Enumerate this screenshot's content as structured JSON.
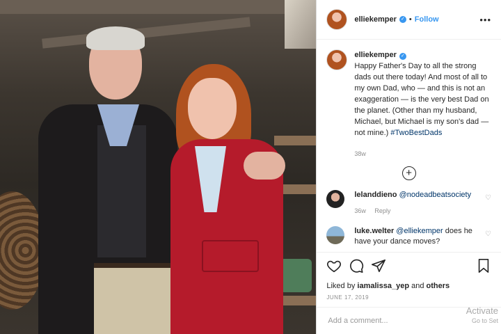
{
  "header": {
    "username": "elliekemper",
    "follow_label": "Follow",
    "separator": "•",
    "more_label": "•••"
  },
  "caption": {
    "username": "elliekemper",
    "text": "Happy Father's Day to all the strong dads out there today! And most of all to my own Dad, who — and this is not an exaggeration — is the very best Dad on the planet. (Other than my husband, Michael, but Michael is my son's dad — not mine.)",
    "hashtag": "#TwoBestDads",
    "time": "38w"
  },
  "load_more_label": "+",
  "comments": [
    {
      "username": "lelanddieno",
      "text": "@nodeadbeatsociety",
      "time": "36w",
      "reply_label": "Reply"
    },
    {
      "username": "luke.welter",
      "mention": "@elliekemper",
      "text": "does he have your dance moves?"
    }
  ],
  "likes": {
    "prefix": "Liked by",
    "user": "iamalissa_yep",
    "conjunction": "and",
    "others": "others"
  },
  "post_date": "JUNE 17, 2019",
  "add_comment_placeholder": "Add a comment...",
  "watermark": {
    "line1": "Activate",
    "line2": "Go to Set"
  },
  "colors": {
    "link_blue": "#3897f0",
    "hashtag_blue": "#003569",
    "muted": "#8e8e8e"
  },
  "icons": {
    "like": "heart-icon",
    "comment": "comment-icon",
    "share": "send-icon",
    "save": "bookmark-icon",
    "verified": "verified-badge-icon"
  }
}
